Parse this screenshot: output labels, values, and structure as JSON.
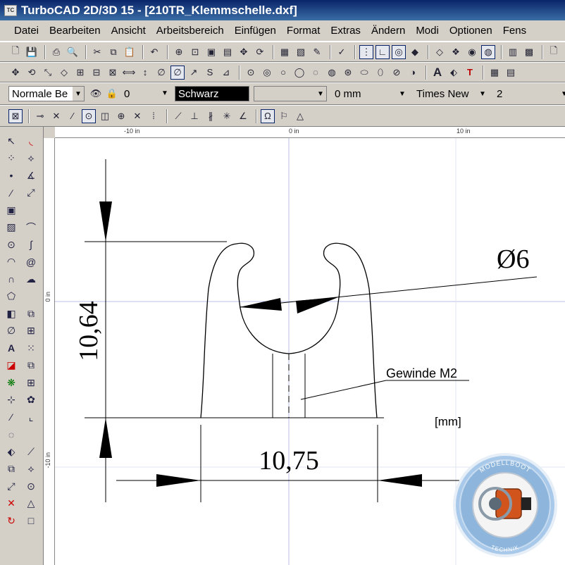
{
  "window": {
    "title": "TurboCAD 2D/3D 15 - [210TR_Klemmschelle.dxf]",
    "logo": "TC"
  },
  "menu": [
    "Datei",
    "Bearbeiten",
    "Ansicht",
    "Arbeitsbereich",
    "Einfügen",
    "Format",
    "Extras",
    "Ändern",
    "Modi",
    "Optionen",
    "Fens"
  ],
  "properties": {
    "layer": "Normale Be",
    "layer_value": "0",
    "color": "Schwarz",
    "thickness": "0 mm",
    "font": "Times New",
    "size": "2"
  },
  "ruler": {
    "top_labels": [
      "-10 in",
      "0 in",
      "10 in"
    ],
    "left_labels": [
      "0 in",
      "-10 in"
    ]
  },
  "drawing": {
    "height_dim": "10,64",
    "width_dim": "10,75",
    "diameter_dim": "Ø6",
    "thread_label": "Gewinde M2",
    "unit_label": "[mm]"
  },
  "logo": {
    "top_text": "MODELLBOOT",
    "bottom_text": "TECHNIK"
  },
  "colors": {
    "title_bar": "#0a246a",
    "chrome": "#d4d0c8",
    "color_swatch": "#000000",
    "guide_lines": "#b8bee8"
  }
}
